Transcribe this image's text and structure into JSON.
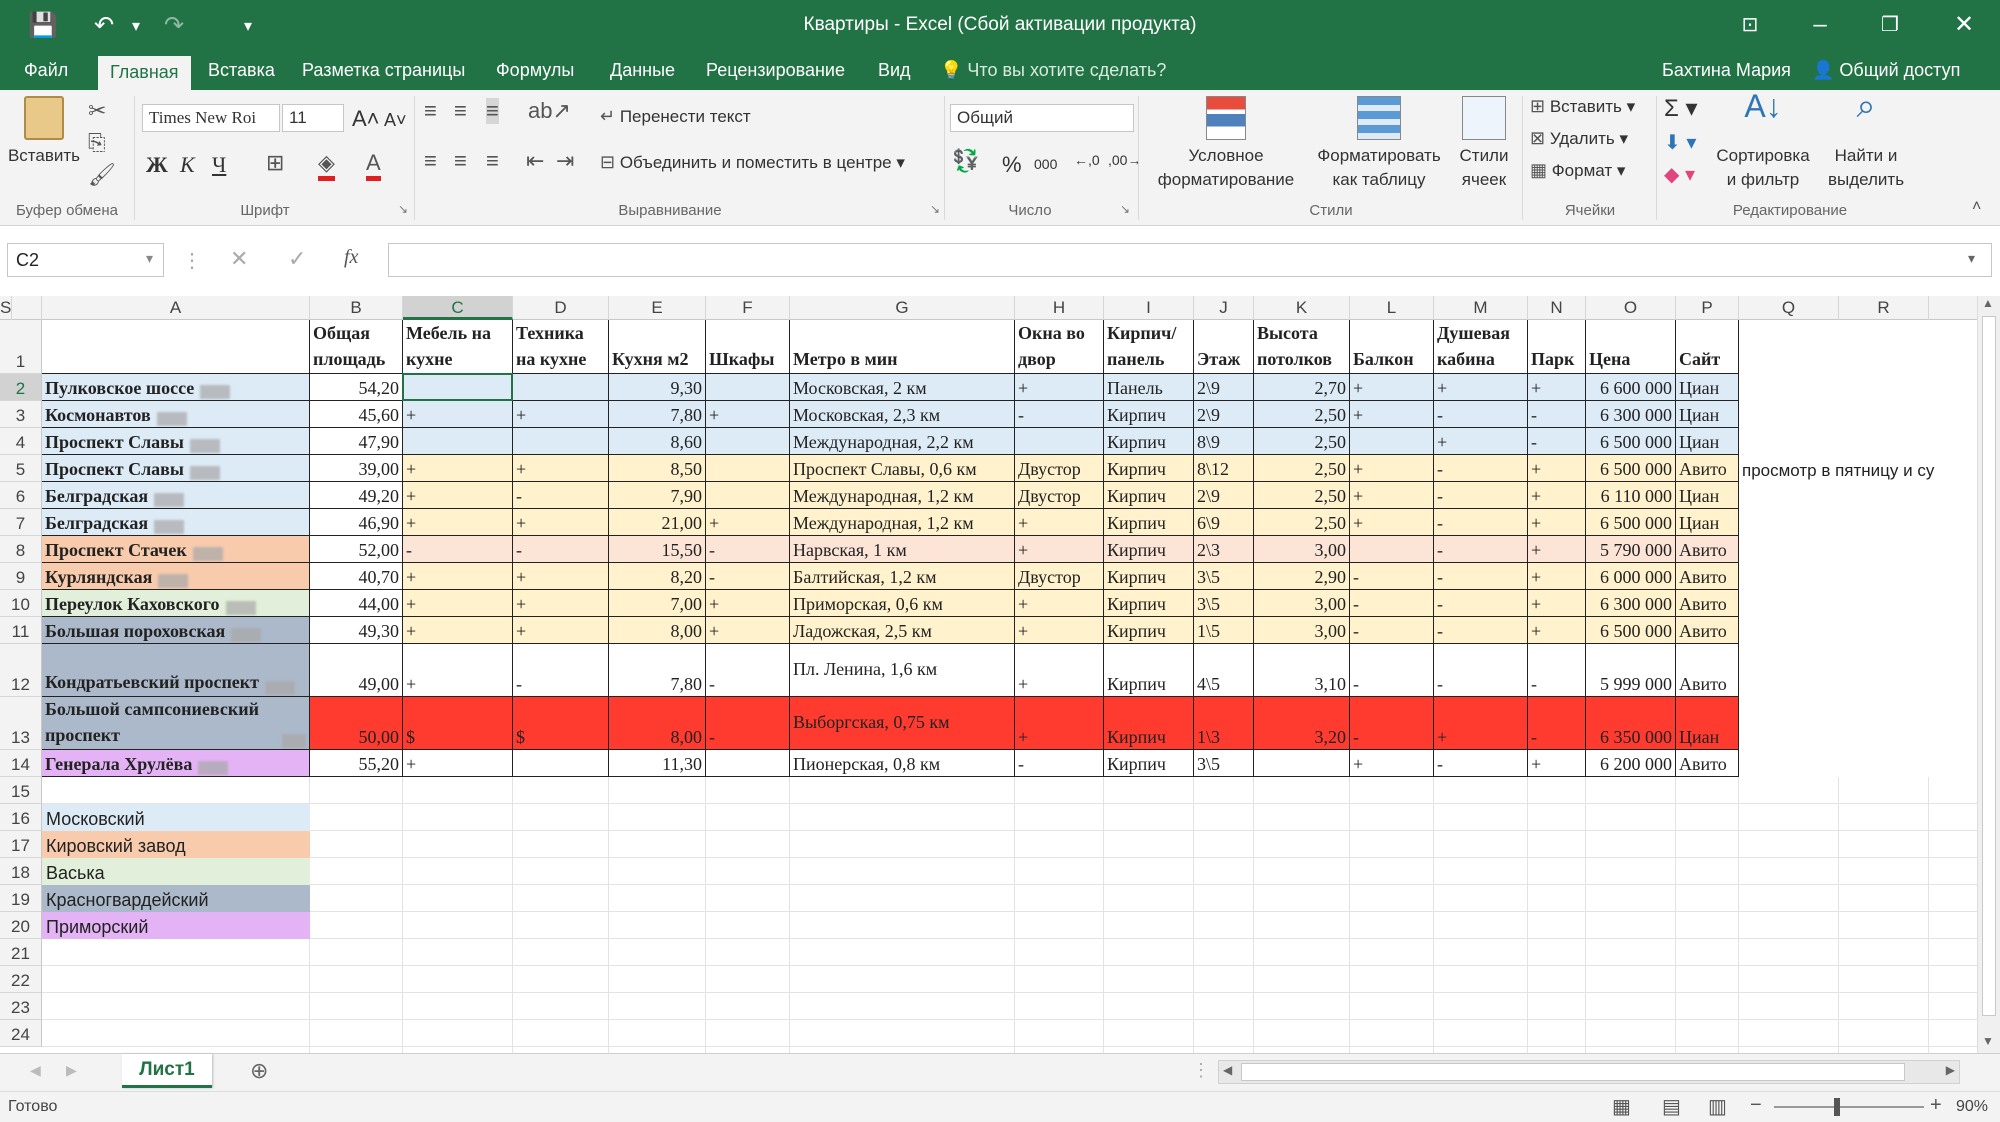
{
  "window": {
    "title": "Квартиры - Excel (Сбой активации продукта)"
  },
  "menu": {
    "tabs": [
      "Файл",
      "Главная",
      "Вставка",
      "Разметка страницы",
      "Формулы",
      "Данные",
      "Рецензирование",
      "Вид"
    ],
    "active": "Главная",
    "tell_me": "Что вы хотите сделать?",
    "user": "Бахтина Мария",
    "share": "Общий доступ"
  },
  "ribbon": {
    "clipboard": {
      "paste": "Вставить",
      "group": "Буфер обмена"
    },
    "font": {
      "name": "Times New Roi",
      "size": "11",
      "bold": "Ж",
      "italic": "К",
      "underline": "Ч",
      "group": "Шрифт"
    },
    "alignment": {
      "wrap": "Перенести текст",
      "merge": "Объединить и поместить в центре",
      "group": "Выравнивание"
    },
    "number": {
      "format": "Общий",
      "group": "Число"
    },
    "styles": {
      "conditional_1": "Условное",
      "conditional_2": "форматирование",
      "table_1": "Форматировать",
      "table_2": "как таблицу",
      "cell_1": "Стили",
      "cell_2": "ячеек",
      "group": "Стили"
    },
    "cells": {
      "insert": "Вставить",
      "delete": "Удалить",
      "format": "Формат",
      "group": "Ячейки"
    },
    "editing": {
      "sort_1": "Сортировка",
      "sort_2": "и фильтр",
      "find_1": "Найти и",
      "find_2": "выделить",
      "group": "Редактирование"
    }
  },
  "formula_bar": {
    "name_box": "C2",
    "fx": "fx",
    "value": ""
  },
  "columns": [
    "A",
    "B",
    "C",
    "D",
    "E",
    "F",
    "G",
    "H",
    "I",
    "J",
    "K",
    "L",
    "M",
    "N",
    "O",
    "P",
    "Q",
    "R",
    "S"
  ],
  "rows": [
    "1",
    "2",
    "3",
    "4",
    "5",
    "6",
    "7",
    "8",
    "9",
    "10",
    "11",
    "12",
    "13",
    "14",
    "15",
    "16",
    "17",
    "18",
    "19",
    "20",
    "21",
    "22",
    "23",
    "24"
  ],
  "headers": [
    "",
    "Общая площадь",
    "Мебель на кухне",
    "Техника на кухне",
    "Кухня м2",
    "Шкафы",
    "Метро в мин",
    "Окна во двор",
    "Кирпич/ панель",
    "Этаж",
    "Высота потолков",
    "Балкон",
    "Душевая кабина",
    "Парк",
    "Цена",
    "Сайт"
  ],
  "data": [
    [
      "Пулковское шоссе",
      "54,20",
      "",
      "",
      "9,30",
      "",
      "Московская, 2 км",
      "+",
      "Панель",
      "2\\9",
      "2,70",
      "+",
      "+",
      "+",
      "6 600 000",
      "Циан"
    ],
    [
      "Космонавтов",
      "45,60",
      "+",
      "+",
      "7,80",
      "+",
      "Московская, 2,3 км",
      "-",
      "Кирпич",
      "2\\9",
      "2,50",
      "+",
      "-",
      "-",
      "6 300 000",
      "Циан"
    ],
    [
      "Проспект Славы",
      "47,90",
      "",
      "",
      "8,60",
      "",
      "Международная, 2,2 км",
      "",
      "Кирпич",
      "8\\9",
      "2,50",
      "",
      "+",
      "-",
      "6 500 000",
      "Циан"
    ],
    [
      "Проспект Славы",
      "39,00",
      "+",
      "+",
      "8,50",
      "",
      "Проспект Славы, 0,6 км",
      "Двустор",
      "Кирпич",
      "8\\12",
      "2,50",
      "+",
      "-",
      "+",
      "6 500 000",
      "Авито"
    ],
    [
      "Белградская",
      "49,20",
      "+",
      "-",
      "7,90",
      "",
      "Международная, 1,2 км",
      "Двустор",
      "Кирпич",
      "2\\9",
      "2,50",
      "+",
      "-",
      "+",
      "6 110 000",
      "Циан"
    ],
    [
      "Белградская",
      "46,90",
      "+",
      "+",
      "21,00",
      "+",
      "Международная, 1,2 км",
      "+",
      "Кирпич",
      "6\\9",
      "2,50",
      "+",
      "-",
      "+",
      "6 500 000",
      "Циан"
    ],
    [
      "Проспект Стачек",
      "52,00",
      "-",
      "-",
      "15,50",
      "-",
      "Нарвская, 1 км",
      "+",
      "Кирпич",
      "2\\3",
      "3,00",
      "",
      "-",
      "+",
      "5 790 000",
      "Авито"
    ],
    [
      "Курляндская",
      "40,70",
      "+",
      "+",
      "8,20",
      "-",
      "Балтийская, 1,2 км",
      "Двустор",
      "Кирпич",
      "3\\5",
      "2,90",
      "-",
      "-",
      "+",
      "6 000 000",
      "Авито"
    ],
    [
      "Переулок Каховского",
      "44,00",
      "+",
      "+",
      "7,00",
      "+",
      "Приморская, 0,6 км",
      "+",
      "Кирпич",
      "3\\5",
      "3,00",
      "-",
      "-",
      "+",
      "6 300 000",
      "Авито"
    ],
    [
      "Большая пороховская",
      "49,30",
      "+",
      "+",
      "8,00",
      "+",
      "Ладожская, 2,5 км",
      "+",
      "Кирпич",
      "1\\5",
      "3,00",
      "-",
      "-",
      "+",
      "6 500 000",
      "Авито"
    ],
    [
      "Кондратьевский проспект",
      "49,00",
      "+",
      "-",
      "7,80",
      "-",
      "Пл. Ленина, 1,6 км",
      "+",
      "Кирпич",
      "4\\5",
      "3,10",
      "-",
      "-",
      "-",
      "5 999 000",
      "Авито"
    ],
    [
      "Большой сампсониевский проспект",
      "50,00",
      "$",
      "$",
      "8,00",
      "-",
      "Выборгская, 0,75 км",
      "+",
      "Кирпич",
      "1\\3",
      "3,20",
      "-",
      "+",
      "-",
      "6 350 000",
      "Циан"
    ],
    [
      "Генерала Хрулёва",
      "55,20",
      "+",
      "",
      "11,30",
      "",
      "Пионерская, 0,8 км",
      "-",
      "Кирпич",
      "3\\5",
      "",
      "+",
      "-",
      "+",
      "6 200 000",
      "Авито"
    ]
  ],
  "note_q5": "просмотр в пятницу и су",
  "legend": [
    "Московский",
    "Кировский завод",
    "Васька",
    "Красногвардейский",
    "Приморский"
  ],
  "sheet": {
    "name": "Лист1"
  },
  "status": {
    "ready": "Готово",
    "zoom": "90%"
  },
  "colors": {
    "accent": "#217346",
    "blue": "#ddebf7",
    "orange": "#f8cbad",
    "yellow": "#fff2cc",
    "peach": "#fce4d6",
    "green": "#e2efda",
    "slate": "#acb9ca",
    "violet": "#e4b3f5",
    "red": "#ff3b30"
  }
}
